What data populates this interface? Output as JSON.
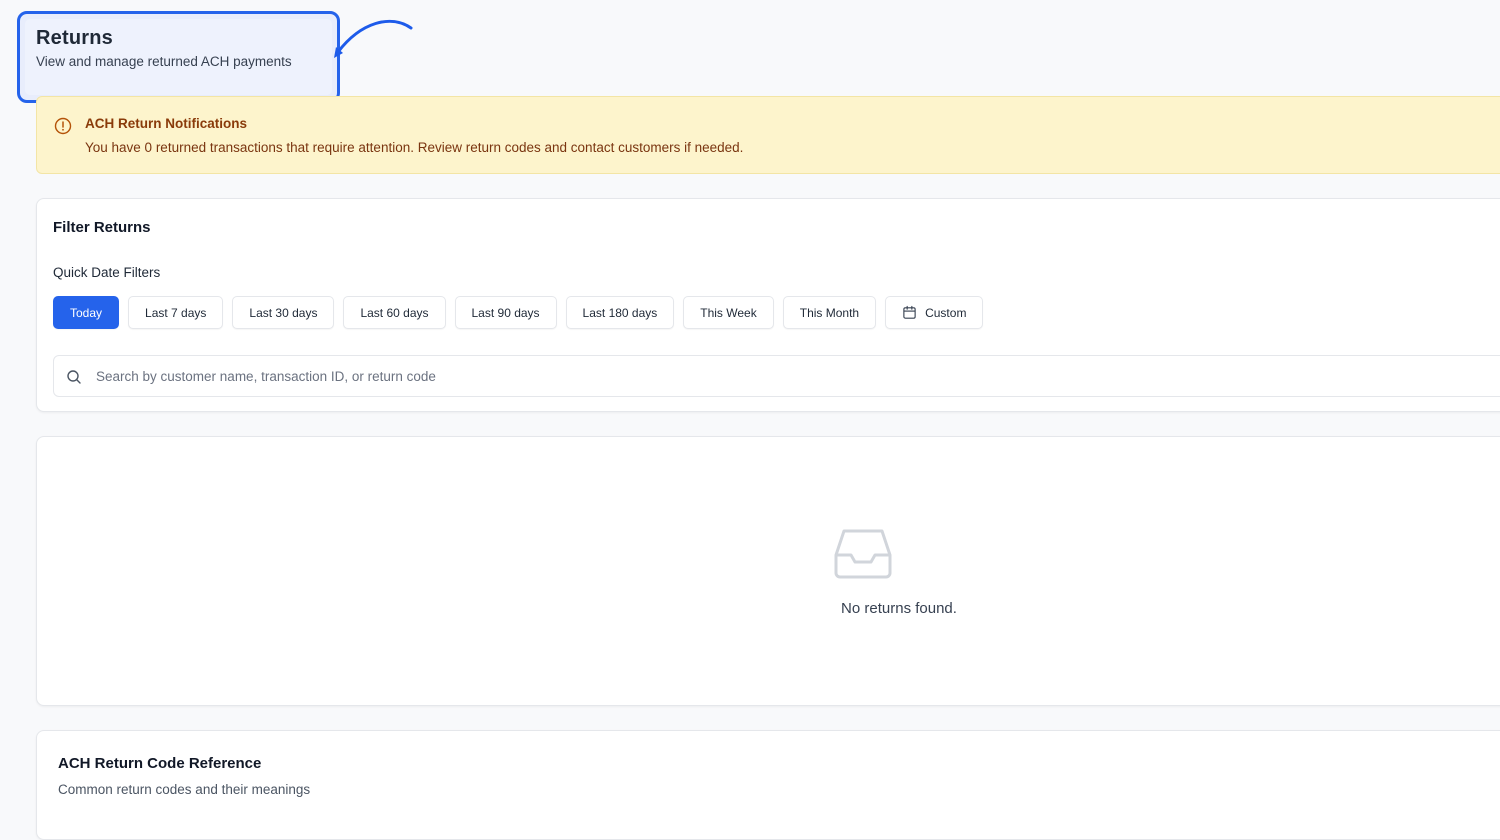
{
  "header": {
    "title": "Returns",
    "subtitle": "View and manage returned ACH payments"
  },
  "alert": {
    "icon": "alert-circle-icon",
    "title": "ACH Return Notifications",
    "message": "You have 0 returned transactions that require attention. Review return codes and contact customers if needed."
  },
  "filters": {
    "title": "Filter Returns",
    "quick_label": "Quick Date Filters",
    "chips": [
      {
        "label": "Today",
        "active": true
      },
      {
        "label": "Last 7 days",
        "active": false
      },
      {
        "label": "Last 30 days",
        "active": false
      },
      {
        "label": "Last 60 days",
        "active": false
      },
      {
        "label": "Last 90 days",
        "active": false
      },
      {
        "label": "Last 180 days",
        "active": false
      },
      {
        "label": "This Week",
        "active": false
      },
      {
        "label": "This Month",
        "active": false
      },
      {
        "label": "Custom",
        "active": false,
        "icon": "calendar-icon"
      }
    ],
    "search_placeholder": "Search by customer name, transaction ID, or return code"
  },
  "results": {
    "empty_icon": "inbox-icon",
    "empty_message": "No returns found."
  },
  "reference": {
    "title": "ACH Return Code Reference",
    "subtitle": "Common return codes and their meanings"
  },
  "colors": {
    "accent": "#2563eb",
    "alert_bg": "#fdf4cc",
    "alert_text": "#8a3b0a"
  }
}
